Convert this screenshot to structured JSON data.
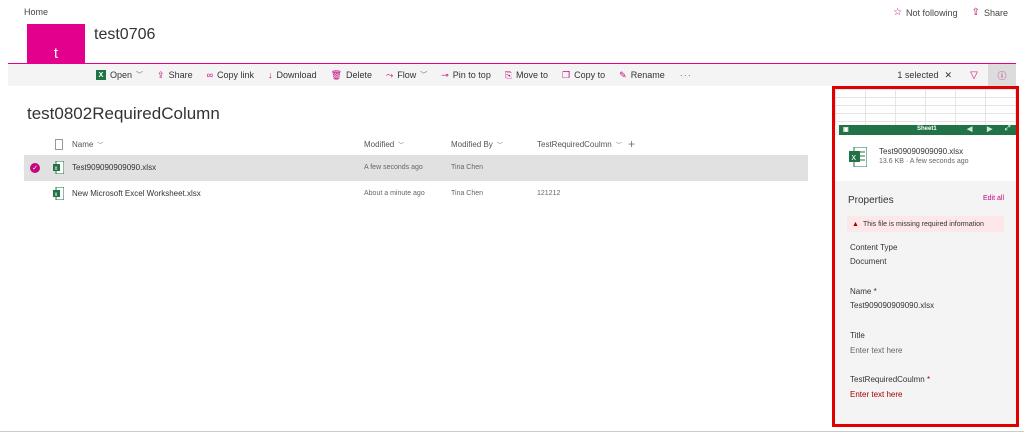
{
  "header": {
    "home": "Home",
    "not_following": "Not following",
    "share": "Share",
    "logo_letter": "t",
    "site_title": "test0706"
  },
  "commandbar": {
    "open": "Open",
    "share": "Share",
    "copy_link": "Copy link",
    "download": "Download",
    "delete": "Delete",
    "flow": "Flow",
    "pin_to_top": "Pin to top",
    "move_to": "Move to",
    "copy_to": "Copy to",
    "rename": "Rename",
    "more": "···",
    "selected": "1 selected"
  },
  "library": {
    "title": "test0802RequiredColumn",
    "columns": {
      "name": "Name",
      "modified": "Modified",
      "modified_by": "Modified By",
      "required": "TestRequiredCoulmn"
    },
    "rows": [
      {
        "name": "Test909090909090.xlsx",
        "modified": "A few seconds ago",
        "modified_by": "Tina Chen",
        "required": ""
      },
      {
        "name": "New Microsoft Excel Worksheet.xlsx",
        "modified": "About a minute ago",
        "modified_by": "Tina Chen",
        "required": "121212"
      }
    ]
  },
  "details": {
    "sheet_name": "Sheet1",
    "file_name": "Test909090909090.xlsx",
    "file_meta": "13.6 KB · A few seconds ago",
    "properties": "Properties",
    "edit_all": "Edit all",
    "warning": "This file is missing required information",
    "content_type_label": "Content Type",
    "content_type_value": "Document",
    "name_label": "Name",
    "name_value": "Test909090909090.xlsx",
    "title_label": "Title",
    "title_placeholder": "Enter text here",
    "required_label": "TestRequiredCoulmn",
    "required_placeholder": "Enter text here",
    "required_marker": "*"
  },
  "colors": {
    "accent": "#e3008c",
    "excel": "#217346",
    "error": "#a80000",
    "highlight_border": "#e00000"
  }
}
